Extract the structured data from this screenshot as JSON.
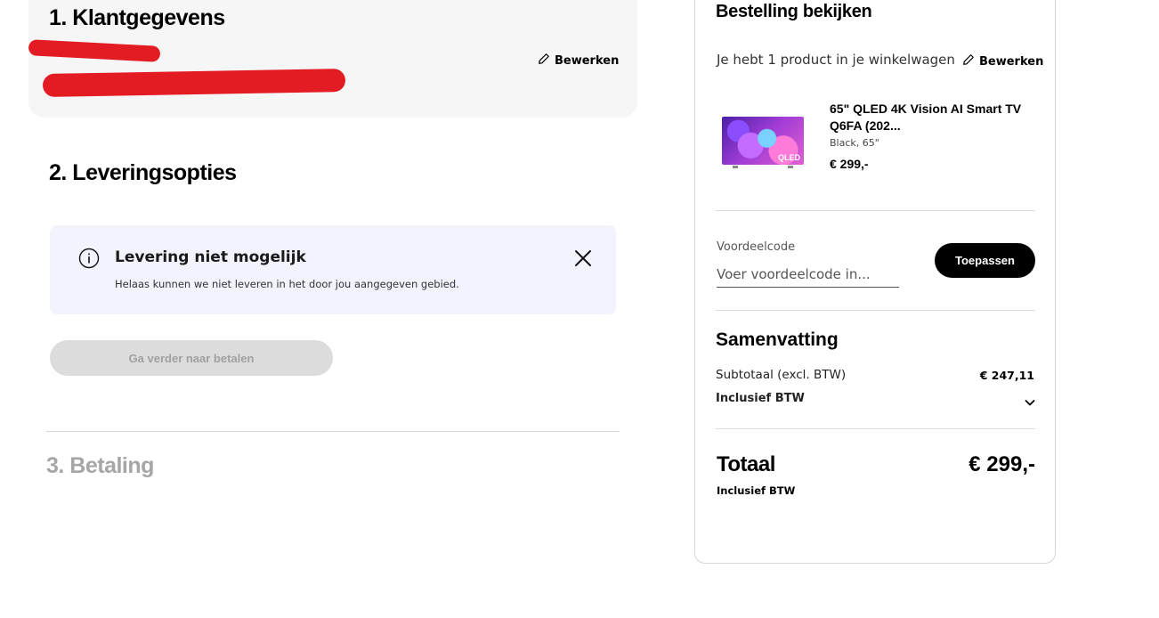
{
  "steps": {
    "customer": {
      "title": "1. Klantgegevens",
      "edit_label": "Bewerken"
    },
    "delivery": {
      "title": "2. Leveringsopties"
    },
    "payment": {
      "title": "3. Betaling"
    }
  },
  "alert": {
    "icon": "info-icon",
    "title": "Levering niet mogelijk",
    "message": "Helaas kunnen we niet leveren in het door jou aangegeven gebied."
  },
  "continue_button": {
    "label": "Ga verder naar betalen",
    "disabled": true
  },
  "order": {
    "title": "Bestelling bekijken",
    "cart_count_text": "Je hebt 1 product in je winkelwagen",
    "edit_label": "Bewerken",
    "product": {
      "name": "65\" QLED 4K Vision AI Smart TV Q6FA (202...",
      "variant": "Black, 65\"",
      "price": "€ 299,-",
      "image_badge": "QLED"
    },
    "promo": {
      "label": "Voordeelcode",
      "placeholder": "Voer voordeelcode in...",
      "apply_label": "Toepassen"
    },
    "summary": {
      "title": "Samenvatting",
      "subtotal_label": "Subtotaal (excl. BTW)",
      "subtotal_value": "€ 247,11",
      "vat_label": "Inclusief BTW",
      "total_label": "Totaal",
      "total_value": "€ 299,-",
      "total_sub": "Inclusief BTW"
    }
  },
  "colors": {
    "accent": "#000000",
    "alert_bg": "#f2f3fc",
    "redaction": "#e31b23",
    "disabled_bg": "#dcdcdc"
  }
}
